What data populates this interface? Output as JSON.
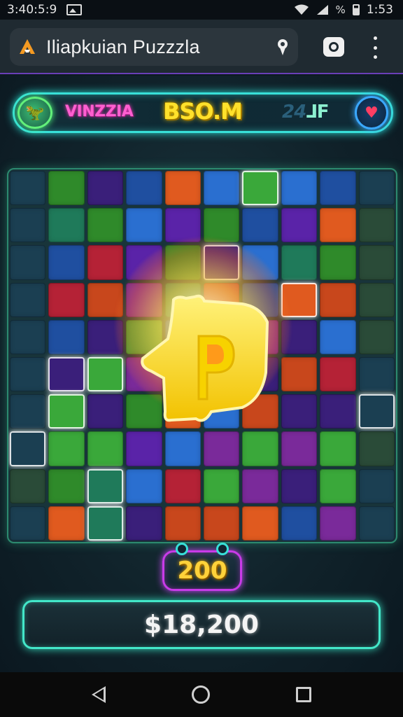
{
  "status_bar": {
    "time": "3:40:5:9",
    "battery_text": "% ▌",
    "clock_right": "1:53"
  },
  "browser": {
    "tab_title": "Iliapkuian Puzzzla",
    "colors": {
      "toolbar": "#1f2a31",
      "accent": "#6a3fb8"
    },
    "icons": [
      "app-logo-icon",
      "pin-icon",
      "camera-icon",
      "overflow-menu-icon"
    ]
  },
  "hud": {
    "player_name": "VINZZIA",
    "score": "BSO.M",
    "extra_text": "24",
    "extra_glyph": "⅃F",
    "heart_icon": "♥",
    "avatar_icon": "🦖"
  },
  "board": {
    "center_piece_label": "P"
  },
  "counter": {
    "value": "200"
  },
  "total": {
    "value": "$18,200"
  },
  "navbar": {
    "icons": [
      "back-icon",
      "home-icon",
      "recents-icon"
    ]
  }
}
